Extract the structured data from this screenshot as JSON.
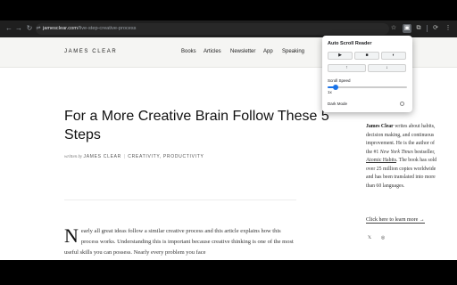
{
  "browser": {
    "url_host": "jamesclear.com",
    "url_path": "/five-step-creative-process",
    "nav_icons": [
      "back-arrow-icon",
      "forward-arrow-icon",
      "reload-icon",
      "site-info-icon"
    ],
    "toolbar_icons": [
      "star-icon",
      "extension-icon",
      "puzzle-icon",
      "sync-icon",
      "menu-icon"
    ],
    "back": "←",
    "forward": "→",
    "reload": "↻",
    "site_info": "⇌",
    "star": "☆",
    "extension": "▣",
    "puzzle": "⧉",
    "sync": "⟳",
    "menu": "⋮"
  },
  "site": {
    "logo": "JAMES CLEAR",
    "nav": [
      "Books",
      "Articles",
      "Newsletter",
      "App",
      "Speaking"
    ]
  },
  "article": {
    "title": "For a More Creative Brain Follow These 5 Steps",
    "written_by": "written by",
    "author": "JAMES CLEAR",
    "categories": "CREATIVITY, PRODUCTIVITY",
    "separator": "|",
    "dropcap": "N",
    "body": "early all great ideas follow a similar creative process and this article explains how this process works. Understanding this is important because creative thinking is one of the most useful skills you can possess. Nearly every problem you face"
  },
  "sidebar": {
    "name": "James Clear",
    "bio_1": " writes about habits, decision making, and continuous improvement. He is the author of the #1 ",
    "bio_nyt": "New York Times",
    "bio_2": " bestseller, ",
    "bio_book": "Atomic Habits",
    "bio_3": ". The book has sold over 25 million copies worldwide and has been translated into more than 60 languages.",
    "cta": "Click here to learn more →",
    "social_icons": [
      "twitter-icon",
      "instagram-icon"
    ],
    "twitter": "𝕏",
    "instagram": "◎"
  },
  "popup": {
    "title": "Auto Scroll Reader",
    "play": "▶",
    "stop": "■",
    "pause": "◐",
    "up": "↑",
    "down": "↓",
    "speed_label": "Scroll Speed",
    "speed_value": "1x",
    "speed_fraction": 0.1,
    "dark_mode_label": "Dark Mode",
    "dark_mode_on": false,
    "accent": "#1a73e8"
  }
}
